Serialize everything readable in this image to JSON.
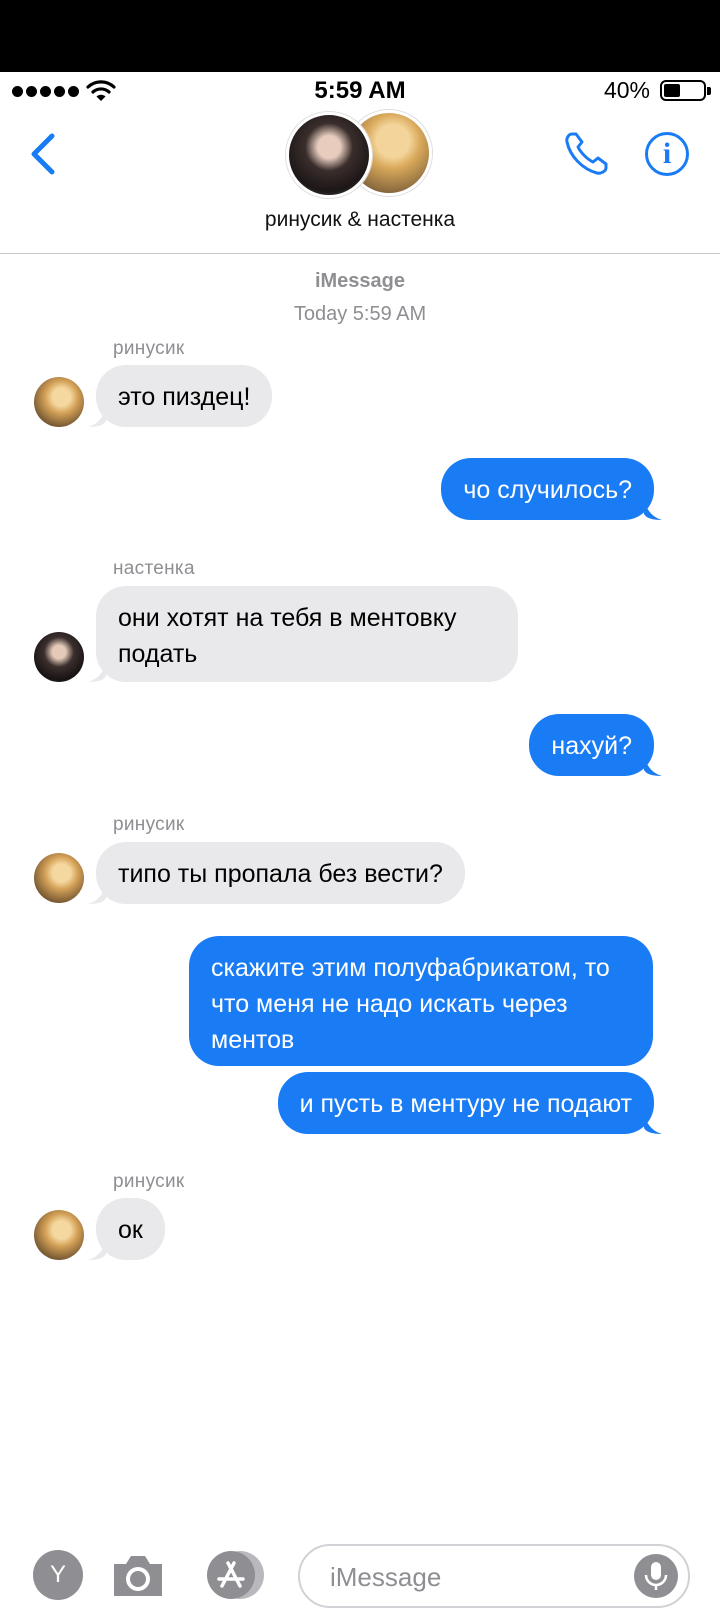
{
  "status": {
    "time": "5:59 AM",
    "battery": "40%",
    "battery_level": 0.4
  },
  "nav": {
    "title": "ринусик & настенка",
    "back_icon": "chevron-left-icon",
    "call_icon": "phone-icon",
    "info_icon": "info-icon",
    "info_glyph": "i"
  },
  "header": {
    "service": "iMessage",
    "timestamp": "Today 5:59 AM"
  },
  "messages": [
    {
      "sender": "ринусик",
      "dir": "in",
      "text": "это пиздец!"
    },
    {
      "dir": "out",
      "text": "чо случилось?"
    },
    {
      "sender": "настенка",
      "dir": "in",
      "text": "они хотят на тебя в ментовку подать"
    },
    {
      "dir": "out",
      "text": "нахуй?"
    },
    {
      "sender": "ринусик",
      "dir": "in",
      "text": "типо ты пропала без вести?"
    },
    {
      "dir": "out",
      "text": "скажите этим полуфабрикатом, то что меня не надо искать через ментов"
    },
    {
      "dir": "out",
      "text": "и пусть в ментуру не подают"
    },
    {
      "sender": "ринусик",
      "dir": "in",
      "text": "ок"
    }
  ],
  "composer": {
    "placeholder": "iMessage",
    "apps_glyph": "Y",
    "icons": [
      "apps-icon",
      "camera-icon",
      "app-store-icon",
      "microphone-icon"
    ]
  },
  "colors": {
    "accent": "#1a7cf5",
    "incoming": "#e9e9eb",
    "muted": "#8e8e93"
  }
}
